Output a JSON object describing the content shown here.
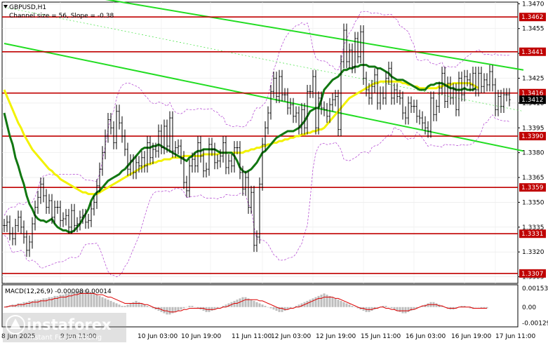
{
  "header": {
    "symbol": "GBPUSD,H1",
    "channel_text": "Channel size = 56, Slope = -0.38",
    "macd_label": "MACD(12,26,9) -0.00008 0.00014"
  },
  "watermark": {
    "brand": "instaforex",
    "tagline": "Instant Forex Trading"
  },
  "colors": {
    "price_bars": "#000000",
    "level_lines": "#c00000",
    "channel": "#22dd22",
    "ma_fast": "#117711",
    "ma_slow": "#f2f200",
    "bollinger": "#b040d0",
    "macd_hist": "#bdbdbd",
    "macd_signal": "#dd0000"
  },
  "chart_data": {
    "type": "candlestick",
    "title": "GBPUSD,H1",
    "x_tick_labels": [
      "8 Jun 2025",
      "9 Jun 11:00",
      "10 Jun 03:00",
      "10 Jun 19:00",
      "11 Jun 11:00",
      "12 Jun 03:00",
      "12 Jun 19:00",
      "15 Jun 11:00",
      "16 Jun 03:00",
      "16 Jun 19:00",
      "17 Jun 11:00"
    ],
    "y_ticks": [
      1.3305,
      1.332,
      1.3335,
      1.335,
      1.3365,
      1.338,
      1.3395,
      1.341,
      1.3425,
      1.344,
      1.3455,
      1.347
    ],
    "ylim": [
      1.3301,
      1.3471
    ],
    "levels": [
      1.3462,
      1.3441,
      1.3416,
      1.339,
      1.3359,
      1.3331,
      1.3307
    ],
    "current_price": 1.3412,
    "close": [
      1.3336,
      1.3338,
      1.3331,
      1.3328,
      1.3336,
      1.3341,
      1.3335,
      1.3329,
      1.3321,
      1.3326,
      1.3337,
      1.3347,
      1.3353,
      1.3361,
      1.3354,
      1.3347,
      1.3351,
      1.3341,
      1.3347,
      1.3347,
      1.3339,
      1.334,
      1.3342,
      1.3335,
      1.3345,
      1.3336,
      1.3337,
      1.3341,
      1.3342,
      1.3338,
      1.3339,
      1.3346,
      1.335,
      1.336,
      1.337,
      1.338,
      1.339,
      1.34,
      1.3395,
      1.3386,
      1.3405,
      1.3398,
      1.339,
      1.3382,
      1.337,
      1.3375,
      1.3368,
      1.3374,
      1.3372,
      1.3377,
      1.3372,
      1.3386,
      1.3377,
      1.3382,
      1.3381,
      1.3393,
      1.3383,
      1.3396,
      1.3384,
      1.3401,
      1.3381,
      1.3383,
      1.3384,
      1.3377,
      1.3362,
      1.3357,
      1.3372,
      1.3376,
      1.3372,
      1.3386,
      1.3378,
      1.3369,
      1.337,
      1.3385,
      1.3382,
      1.3374,
      1.3375,
      1.3378,
      1.3386,
      1.3371,
      1.3375,
      1.3372,
      1.3383,
      1.3383,
      1.3368,
      1.3358,
      1.3365,
      1.3347,
      1.3356,
      1.3324,
      1.3329,
      1.3361,
      1.3385,
      1.3395,
      1.3404,
      1.3417,
      1.3425,
      1.3414,
      1.3426,
      1.3415,
      1.3415,
      1.3407,
      1.3409,
      1.3402,
      1.3404,
      1.3395,
      1.3406,
      1.3395,
      1.3417,
      1.3417,
      1.3426,
      1.3395,
      1.3413,
      1.3407,
      1.3406,
      1.3402,
      1.3409,
      1.3412,
      1.3414,
      1.3394,
      1.3435,
      1.3454,
      1.3435,
      1.3442,
      1.3432,
      1.3449,
      1.3438,
      1.3453,
      1.3425,
      1.3418,
      1.3413,
      1.342,
      1.3427,
      1.341,
      1.3416,
      1.3413,
      1.3425,
      1.3431,
      1.3413,
      1.3418,
      1.3414,
      1.3413,
      1.3404,
      1.3401,
      1.341,
      1.3408,
      1.3408,
      1.3402,
      1.3401,
      1.3398,
      1.3395,
      1.3393,
      1.3413,
      1.3403,
      1.3408,
      1.3419,
      1.3428,
      1.3411,
      1.3422,
      1.3413,
      1.3418,
      1.3406,
      1.3425,
      1.3415,
      1.3426,
      1.3424,
      1.3421,
      1.3428,
      1.3418,
      1.3428,
      1.342,
      1.3424,
      1.3421,
      1.3429,
      1.3421,
      1.3406,
      1.3414,
      1.3408,
      1.3415,
      1.3415,
      1.3412
    ],
    "channel_lines": [
      {
        "x": [
          0,
          185
        ],
        "y": [
          1.3446,
          1.3381
        ]
      },
      {
        "x": [
          0,
          185
        ],
        "y": [
          1.3483,
          1.343
        ]
      }
    ],
    "series": [
      {
        "type": "ma_fast",
        "values": [
          1.3404,
          1.3397,
          1.339,
          1.3385,
          1.3377,
          1.3372,
          1.3366,
          1.3361,
          1.3354,
          1.3349,
          1.3346,
          1.3342,
          1.334,
          1.3339,
          1.3339,
          1.3338,
          1.3339,
          1.334,
          1.3337,
          1.3335,
          1.3334,
          1.3333,
          1.3333,
          1.3332,
          1.3332,
          1.3333,
          1.3335,
          1.3337,
          1.334,
          1.3343,
          1.3346,
          1.3351,
          1.3354,
          1.3356,
          1.3357,
          1.3359,
          1.3361,
          1.3363,
          1.3364,
          1.3365,
          1.3366,
          1.3367,
          1.3369,
          1.337,
          1.3372,
          1.3374,
          1.3376,
          1.3378,
          1.338,
          1.3382,
          1.3383,
          1.3383,
          1.3383,
          1.3384,
          1.3384,
          1.3385,
          1.3384,
          1.3383,
          1.3382,
          1.3381,
          1.338,
          1.3379,
          1.3378,
          1.3377,
          1.3376,
          1.3375,
          1.3377,
          1.3378,
          1.338,
          1.3381,
          1.3381,
          1.3382,
          1.3382,
          1.3382,
          1.3382,
          1.3382,
          1.3381,
          1.338,
          1.338,
          1.338,
          1.338,
          1.338,
          1.3378,
          1.3375,
          1.3371,
          1.3369,
          1.3368,
          1.3369,
          1.337,
          1.3372,
          1.3374,
          1.3377,
          1.338,
          1.3381,
          1.3383,
          1.3385,
          1.3387,
          1.3389,
          1.339,
          1.3391,
          1.3392,
          1.3393,
          1.3393,
          1.3393,
          1.3394,
          1.3395,
          1.3397,
          1.3399,
          1.3402,
          1.3405,
          1.3406,
          1.3407,
          1.3407,
          1.3412,
          1.3418,
          1.342,
          1.3422,
          1.3424,
          1.3425,
          1.3426,
          1.3428,
          1.343,
          1.343,
          1.3431,
          1.3431,
          1.3432,
          1.3432,
          1.3433,
          1.3433,
          1.3433,
          1.3432,
          1.3432,
          1.3432,
          1.3431,
          1.3431,
          1.343,
          1.3429,
          1.3428,
          1.3426,
          1.3425,
          1.3424,
          1.3424,
          1.3424,
          1.3423,
          1.3422,
          1.3421,
          1.342,
          1.3419,
          1.3418,
          1.3418,
          1.3418,
          1.342,
          1.3421,
          1.3421,
          1.3422,
          1.3422,
          1.3422,
          1.3421,
          1.342,
          1.3419,
          1.3419,
          1.3418,
          1.3418,
          1.3418,
          1.3419,
          1.3418,
          1.3418,
          1.3418,
          1.3419
        ]
      },
      {
        "type": "ma_slow",
        "values": [
          1.3418,
          1.3414,
          1.341,
          1.3406,
          1.3402,
          1.3398,
          1.3395,
          1.3391,
          1.3388,
          1.3385,
          1.3382,
          1.338,
          1.3378,
          1.3376,
          1.3374,
          1.3372,
          1.337,
          1.3369,
          1.3367,
          1.3366,
          1.3364,
          1.3363,
          1.3362,
          1.3361,
          1.336,
          1.3359,
          1.3358,
          1.3357,
          1.3356,
          1.3356,
          1.3355,
          1.3355,
          1.3355,
          1.3355,
          1.3356,
          1.3357,
          1.3358,
          1.3359,
          1.336,
          1.3361,
          1.3362,
          1.3363,
          1.3364,
          1.3365,
          1.3366,
          1.3367,
          1.3368,
          1.3369,
          1.337,
          1.3371,
          1.3372,
          1.3373,
          1.3373,
          1.3374,
          1.3374,
          1.3375,
          1.3375,
          1.3376,
          1.3376,
          1.3376,
          1.3377,
          1.3377,
          1.3377,
          1.3377,
          1.3378,
          1.3378,
          1.3378,
          1.3378,
          1.3378,
          1.3378,
          1.3378,
          1.3379,
          1.3379,
          1.3379,
          1.3379,
          1.3379,
          1.3379,
          1.338,
          1.338,
          1.338,
          1.338,
          1.338,
          1.338,
          1.338,
          1.338,
          1.338,
          1.3381,
          1.3381,
          1.3382,
          1.3382,
          1.3383,
          1.3383,
          1.3384,
          1.3384,
          1.3385,
          1.3385,
          1.3386,
          1.3386,
          1.3387,
          1.3387,
          1.3388,
          1.3388,
          1.3389,
          1.3389,
          1.339,
          1.339,
          1.3391,
          1.3391,
          1.3392,
          1.3392,
          1.3393,
          1.3393,
          1.3394,
          1.3394,
          1.3395,
          1.3397,
          1.3399,
          1.3401,
          1.3403,
          1.3405,
          1.3407,
          1.3409,
          1.3411,
          1.3413,
          1.3414,
          1.3415,
          1.3416,
          1.3417,
          1.3418,
          1.3419,
          1.342,
          1.3421,
          1.3422,
          1.3422,
          1.3423,
          1.3423,
          1.3423,
          1.3423,
          1.3423,
          1.3423,
          1.3423,
          1.3423,
          1.3422,
          1.3422,
          1.3421,
          1.3421,
          1.342,
          1.342,
          1.3419,
          1.3419,
          1.3419,
          1.3419,
          1.3419,
          1.3419,
          1.3419,
          1.342,
          1.342,
          1.3421,
          1.3421,
          1.3421,
          1.3422,
          1.3422,
          1.3422,
          1.3422,
          1.3422,
          1.3422,
          1.3422,
          1.3421,
          1.342,
          1.3419
        ]
      }
    ],
    "macd": {
      "y_ticks": [
        0.00153,
        0.0,
        -0.00129
      ],
      "ylim": [
        -0.0016,
        0.0018
      ],
      "histogram": [
        0.0,
        0.0001,
        0.0001,
        0.0002,
        0.0002,
        0.0003,
        0.0003,
        0.0004,
        0.0004,
        0.0005,
        0.0005,
        0.0006,
        0.0006,
        0.0006,
        0.0007,
        0.0007,
        0.0008,
        0.0008,
        0.0009,
        0.0009,
        0.001,
        0.001,
        0.0011,
        0.0011,
        0.0012,
        0.0012,
        0.0013,
        0.0013,
        0.0014,
        0.0014,
        0.0013,
        0.0012,
        0.0011,
        0.001,
        0.0009,
        0.0008,
        0.0007,
        0.0006,
        0.0005,
        0.0004,
        0.0003,
        0.0002,
        0.0001,
        0.0001,
        0.0002,
        0.0003,
        0.0004,
        0.0005,
        0.0004,
        0.0003,
        0.0002,
        0.0001,
        0.0,
        -0.0001,
        -0.0002,
        -0.0003,
        -0.0004,
        -0.0005,
        -0.0006,
        -0.0006,
        -0.0005,
        -0.0004,
        -0.0003,
        -0.0002,
        -0.0001,
        0.0,
        0.0001,
        0.0001,
        0.0,
        -0.0001,
        -0.0002,
        -0.0003,
        -0.0004,
        -0.0004,
        -0.0003,
        -0.0002,
        -0.0001,
        0.0,
        0.0001,
        0.0002,
        0.0003,
        0.0004,
        0.0005,
        0.0006,
        0.0007,
        0.0008,
        0.0008,
        0.0007,
        0.0006,
        0.0005,
        0.0004,
        0.0003,
        0.0002,
        0.0001,
        0.0,
        -0.0001,
        -0.0002,
        -0.0003,
        -0.0004,
        -0.0004,
        -0.0003,
        -0.0002,
        -0.0001,
        0.0,
        0.0001,
        0.0002,
        0.0003,
        0.0004,
        0.0005,
        0.0006,
        0.0007,
        0.0008,
        0.0009,
        0.001,
        0.0011,
        0.001,
        0.0009,
        0.0008,
        0.0007,
        0.0006,
        0.0005,
        0.0004,
        0.0003,
        0.0002,
        0.0001,
        0.0,
        -0.0001,
        -0.0002,
        -0.0003,
        -0.0004,
        -0.0004,
        -0.0003,
        -0.0002,
        -0.0001,
        0.0,
        0.0001,
        0.0001,
        0.0,
        -0.0001,
        -0.0002,
        -0.0003,
        -0.0004,
        -0.0005,
        -0.0005,
        -0.0004,
        -0.0003,
        -0.0002,
        -0.0001,
        0.0,
        0.0001,
        0.0002,
        0.0003,
        0.0004,
        0.0004,
        0.0003,
        0.0002,
        0.0001,
        0.0,
        -0.0001,
        -0.0002,
        -0.0002,
        -0.0001,
        0.0,
        0.0001,
        0.0001,
        0.0,
        -0.0001,
        -0.0001,
        0.0,
        0.0,
        -0.0001,
        -0.0001,
        -0.0001
      ],
      "signal": [
        0.0,
        0.0,
        0.0001,
        0.0001,
        0.0001,
        0.0002,
        0.0002,
        0.0002,
        0.0003,
        0.0003,
        0.0004,
        0.0004,
        0.0004,
        0.0005,
        0.0005,
        0.0005,
        0.0006,
        0.0006,
        0.0007,
        0.0007,
        0.0008,
        0.0008,
        0.0008,
        0.0009,
        0.0009,
        0.001,
        0.001,
        0.0011,
        0.0011,
        0.0011,
        0.0011,
        0.0011,
        0.0011,
        0.001,
        0.001,
        0.001,
        0.0009,
        0.0008,
        0.0008,
        0.0007,
        0.0006,
        0.0005,
        0.0004,
        0.0003,
        0.0003,
        0.0003,
        0.0003,
        0.0003,
        0.0003,
        0.0003,
        0.0002,
        0.0002,
        0.0001,
        0.0,
        -0.0001,
        -0.0001,
        -0.0002,
        -0.0003,
        -0.0003,
        -0.0004,
        -0.0004,
        -0.0004,
        -0.0003,
        -0.0003,
        -0.0002,
        -0.0002,
        -0.0001,
        -0.0001,
        -0.0001,
        -0.0001,
        -0.0001,
        -0.0001,
        -0.0002,
        -0.0002,
        -0.0002,
        -0.0002,
        -0.0001,
        -0.0001,
        0.0,
        0.0,
        0.0001,
        0.0002,
        0.0003,
        0.0003,
        0.0004,
        0.0005,
        0.0006,
        0.0006,
        0.0006,
        0.0006,
        0.0006,
        0.0005,
        0.0005,
        0.0004,
        0.0003,
        0.0002,
        0.0001,
        0.0,
        -0.0001,
        -0.0001,
        -0.0002,
        -0.0002,
        -0.0001,
        -0.0001,
        0.0,
        0.0,
        0.0001,
        0.0002,
        0.0003,
        0.0004,
        0.0005,
        0.0006,
        0.0007,
        0.0007,
        0.0008,
        0.0008,
        0.0008,
        0.0008,
        0.0007,
        0.0007,
        0.0006,
        0.0005,
        0.0004,
        0.0003,
        0.0002,
        0.0001,
        0.0,
        -0.0001,
        -0.0001,
        -0.0002,
        -0.0002,
        -0.0002,
        -0.0001,
        -0.0001,
        0.0,
        0.0,
        -0.0001,
        -0.0001,
        -0.0002,
        -0.0002,
        -0.0003,
        -0.0003,
        -0.0003,
        -0.0003,
        -0.0003,
        -0.0002,
        -0.0002,
        -0.0001,
        0.0,
        0.0001,
        0.0001,
        0.0002,
        0.0002,
        0.0002,
        0.0002,
        0.0001,
        0.0001,
        0.0,
        -0.0001,
        -0.0001,
        -0.0001,
        -0.0001,
        0.0,
        0.0,
        0.0,
        0.0,
        0.0,
        -0.0001,
        -0.0001,
        -0.0001,
        -0.0001,
        -0.0001,
        -0.0001
      ]
    }
  }
}
